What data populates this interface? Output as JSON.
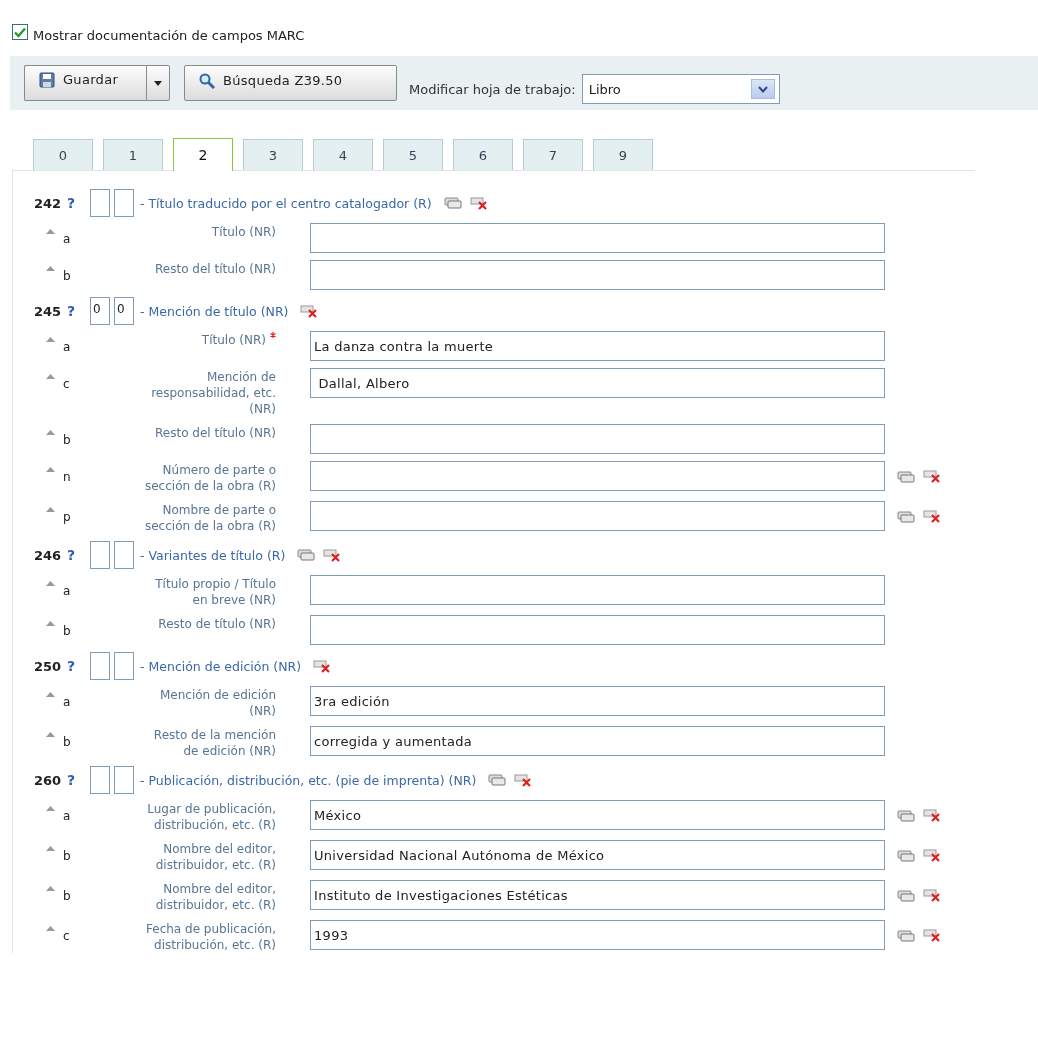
{
  "show_docs": {
    "label": "Mostrar documentación de campos MARC",
    "checked": true
  },
  "toolbar": {
    "save_button": "Guardar",
    "search_button": "Búsqueda Z39.50",
    "worksheet_label": "Modificar hoja de trabajo:",
    "worksheet_value": "Libro"
  },
  "tabs": [
    {
      "label": "0",
      "selected": false
    },
    {
      "label": "1",
      "selected": false
    },
    {
      "label": "2",
      "selected": true
    },
    {
      "label": "3",
      "selected": false
    },
    {
      "label": "4",
      "selected": false
    },
    {
      "label": "5",
      "selected": false
    },
    {
      "label": "6",
      "selected": false
    },
    {
      "label": "7",
      "selected": false
    },
    {
      "label": "9",
      "selected": false
    }
  ],
  "fields": [
    {
      "tag": "242",
      "help": "?",
      "title": "- Título traducido por el centro catalogador (R)",
      "repeatable": true,
      "subfields": [
        {
          "code": "a",
          "label": "Título (NR)",
          "required": false,
          "repeatable": false
        },
        {
          "code": "b",
          "label": "Resto del título (NR)",
          "required": false,
          "repeatable": false
        }
      ]
    },
    {
      "tag": "245",
      "help": "?",
      "indicators": [
        "0",
        "0"
      ],
      "title": "- Mención de título (NR)",
      "repeatable": false,
      "subfields": [
        {
          "code": "a",
          "label": "Título (NR)",
          "required": true,
          "value": "La danza contra la muerte",
          "repeatable": false
        },
        {
          "code": "c",
          "label": "Mención de\nresponsabilidad, etc.\n(NR)",
          "required": false,
          "value": " Dallal, Albero",
          "repeatable": false
        },
        {
          "code": "b",
          "label": "Resto del título (NR)",
          "required": false,
          "repeatable": false
        },
        {
          "code": "n",
          "label": "Número de parte o\nsección de la obra (R)",
          "required": false,
          "repeatable": true
        },
        {
          "code": "p",
          "label": "Nombre de parte o\nsección de la obra (R)",
          "required": false,
          "repeatable": true
        }
      ]
    },
    {
      "tag": "246",
      "help": "?",
      "title": "- Variantes de título (R)",
      "repeatable": true,
      "subfields": [
        {
          "code": "a",
          "label": "Título propio / Título\nen breve (NR)",
          "required": false,
          "repeatable": false
        },
        {
          "code": "b",
          "label": "Resto de título (NR)",
          "required": false,
          "repeatable": false
        }
      ]
    },
    {
      "tag": "250",
      "help": "?",
      "title": "- Mención de edición (NR)",
      "repeatable": false,
      "subfields": [
        {
          "code": "a",
          "label": "Mención de edición\n(NR)",
          "required": false,
          "value": "3ra edición",
          "repeatable": false
        },
        {
          "code": "b",
          "label": "Resto de la mención\nde edición (NR)",
          "required": false,
          "value": "corregida y aumentada",
          "repeatable": false
        }
      ]
    },
    {
      "tag": "260",
      "help": "?",
      "title": "- Publicación, distribución, etc. (pie de imprenta) (NR)",
      "repeatable": true,
      "subfields": [
        {
          "code": "a",
          "label": "Lugar de publicación,\ndistribución, etc. (R)",
          "required": false,
          "value": "México",
          "repeatable": true
        },
        {
          "code": "b",
          "label": "Nombre del editor,\ndistribuidor, etc. (R)",
          "required": false,
          "value": "Universidad Nacional Autónoma de México",
          "repeatable": true
        },
        {
          "code": "b",
          "label": "Nombre del editor,\ndistribuidor, etc. (R)",
          "required": false,
          "value": "Instituto de Investigaciones Estéticas",
          "repeatable": true
        },
        {
          "code": "c",
          "label": "Fecha de publicación,\ndistribución, etc. (R)",
          "required": false,
          "value": "1993",
          "repeatable": true
        }
      ]
    }
  ]
}
